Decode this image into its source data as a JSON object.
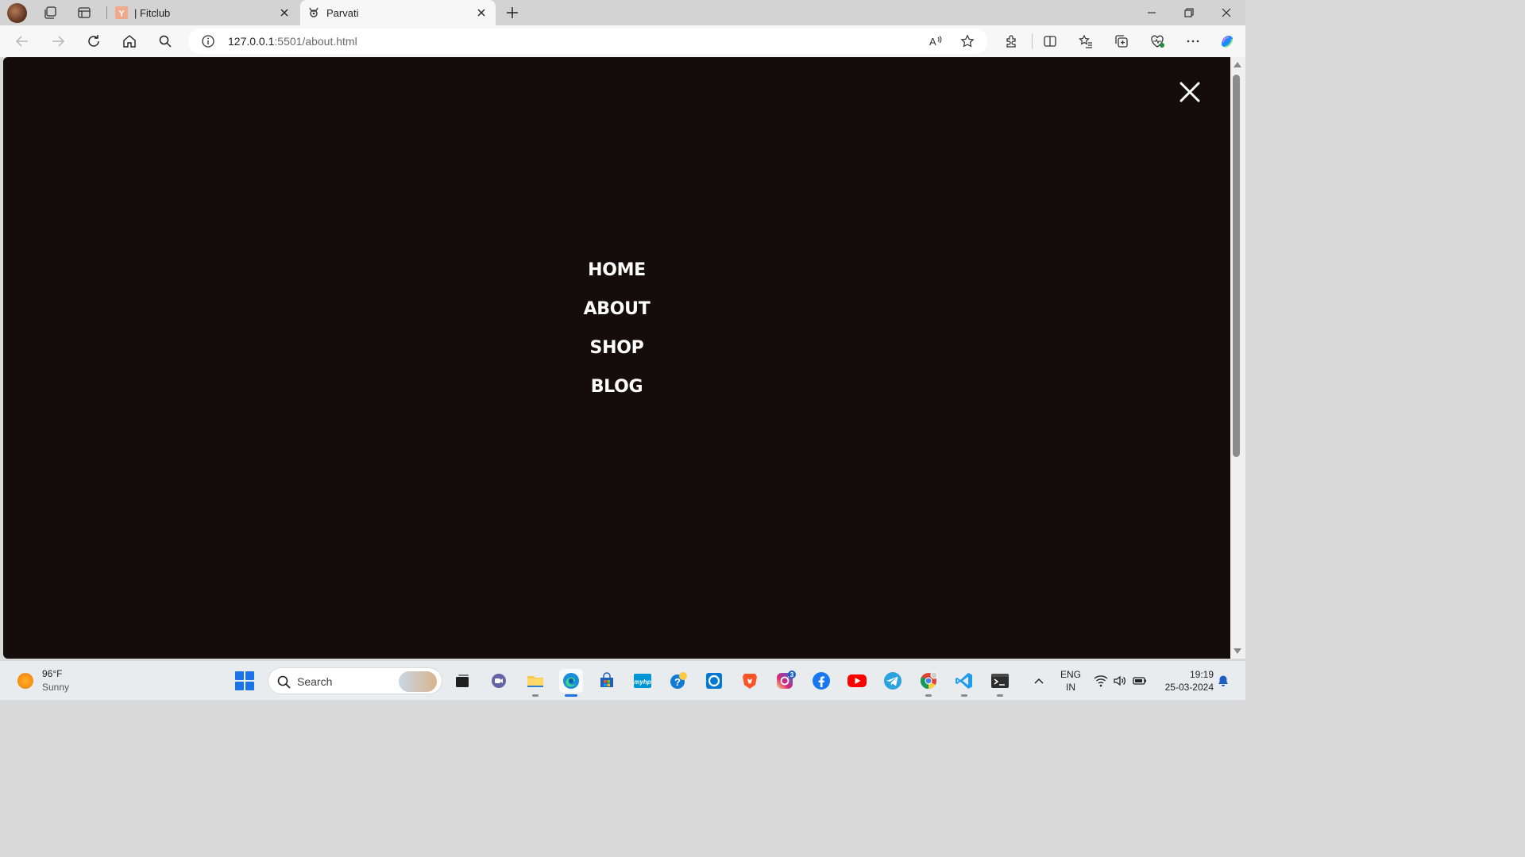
{
  "browser": {
    "tabs": [
      {
        "title": "| Fitclub",
        "favicon": "fitclub-y-favicon"
      },
      {
        "title": "Parvati",
        "favicon": "parvati-favicon"
      }
    ],
    "url_host": "127.0.0.1",
    "url_rest": ":5501/about.html"
  },
  "page": {
    "background": "#140d0b",
    "nav": [
      "HOME",
      "ABOUT",
      "SHOP",
      "BLOG"
    ]
  },
  "taskbar": {
    "weather_temp": "96°F",
    "weather_condition": "Sunny",
    "search_placeholder": "Search",
    "instagram_badge": "3",
    "lang_line1": "ENG",
    "lang_line2": "IN",
    "time": "19:19",
    "date": "25-03-2024"
  }
}
